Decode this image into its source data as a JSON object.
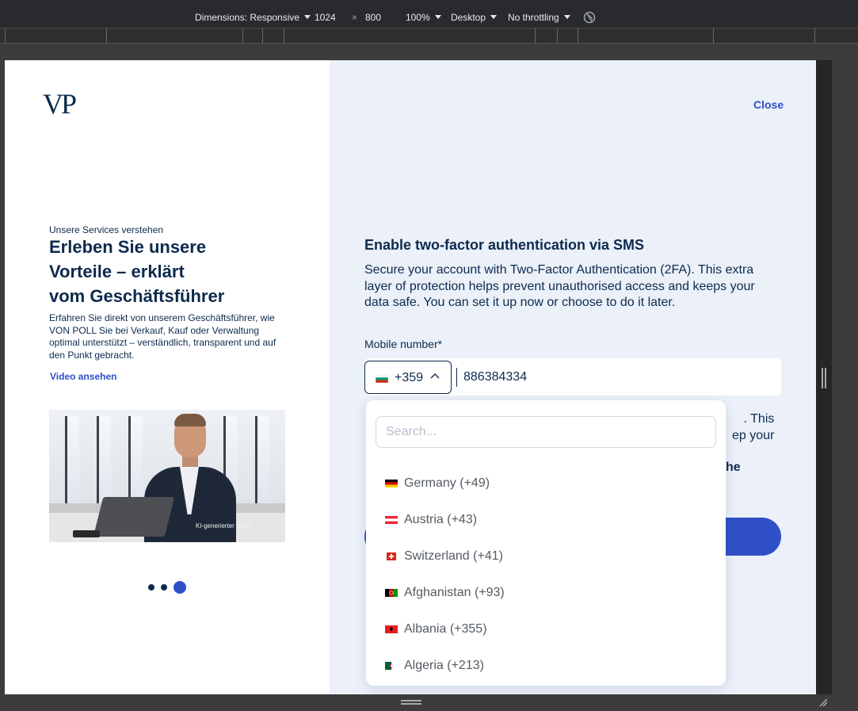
{
  "devtools": {
    "dimensions_label": "Dimensions: Responsive",
    "width": "1024",
    "times": "×",
    "height": "800",
    "zoom": "100%",
    "device": "Desktop",
    "throttling": "No throttling"
  },
  "left": {
    "logo": "VP",
    "eyebrow": "Unsere Services verstehen",
    "headline": [
      "Erleben Sie unsere",
      "Vorteile – erklärt",
      "vom Geschäftsführer"
    ],
    "description": "Erfahren Sie direkt von unserem Geschäftsführer, wie VON POLL Sie bei Verkauf, Kauf oder Verwaltung optimal unterstützt – verständlich, transparent und auf den Punkt gebracht.",
    "video_link": "Video ansehen",
    "video_caption": "KI-generierter Inhalt",
    "carousel": {
      "count": 3,
      "active": 3
    }
  },
  "right": {
    "close_label": "Close",
    "title": "Enable two-factor authentication via SMS",
    "subtitle": "Secure your account with Two-Factor Authentication (2FA). This extra layer of protection helps prevent unauthorised access and keeps your data safe. You can set it up now or choose to do it later.",
    "field_label": "Mobile number*",
    "dial_code": "+359",
    "phone_value": "886384334",
    "partial_line1": ". This",
    "partial_line2": "ep your",
    "partial_bold": "he"
  },
  "dropdown": {
    "search_placeholder": "Search...",
    "items": [
      {
        "label": "Germany (+49)",
        "flag": "de"
      },
      {
        "label": "Austria (+43)",
        "flag": "at"
      },
      {
        "label": "Switzerland (+41)",
        "flag": "ch"
      },
      {
        "label": "Afghanistan (+93)",
        "flag": "af"
      },
      {
        "label": "Albania (+355)",
        "flag": "al"
      },
      {
        "label": "Algeria (+213)",
        "flag": "dz"
      }
    ]
  },
  "colors": {
    "navy": "#0d2a4d",
    "accent": "#2f50c9",
    "panel_bg": "#ebf0f9"
  }
}
